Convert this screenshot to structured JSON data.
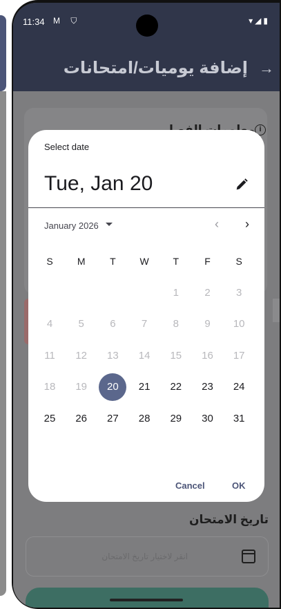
{
  "status_bar": {
    "time": "11:34",
    "left_icons": "M ⛉",
    "right_icons": "▾◢▮"
  },
  "app_bar": {
    "title": "إضافة يوميات/امتحانات",
    "back_icon": "arrow-right-icon"
  },
  "form": {
    "section_heading": "معلومات الفصل",
    "exam_date_label": "تاريخ الامتحان",
    "exam_date_placeholder": "انقر لاختيار تاريخ الامتحان"
  },
  "date_picker": {
    "header": "Select date",
    "selected_date": "Tue, Jan 20",
    "month_label": "January 2026",
    "weekdays": [
      "S",
      "M",
      "T",
      "W",
      "T",
      "F",
      "S"
    ],
    "weeks": [
      [
        null,
        null,
        null,
        null,
        "1",
        "2",
        "3"
      ],
      [
        "4",
        "5",
        "6",
        "7",
        "8",
        "9",
        "10"
      ],
      [
        "11",
        "12",
        "13",
        "14",
        "15",
        "16",
        "17"
      ],
      [
        "18",
        "19",
        "20",
        "21",
        "22",
        "23",
        "24"
      ],
      [
        "25",
        "26",
        "27",
        "28",
        "29",
        "30",
        "31"
      ]
    ],
    "selected_day": "20",
    "first_enabled_day": "20",
    "actions": {
      "cancel": "Cancel",
      "ok": "OK"
    }
  },
  "colors": {
    "app_bar": "#30364a",
    "selected_day": "#5b678c",
    "action_text": "#4c5578",
    "submit_button": "#3d6e63"
  }
}
